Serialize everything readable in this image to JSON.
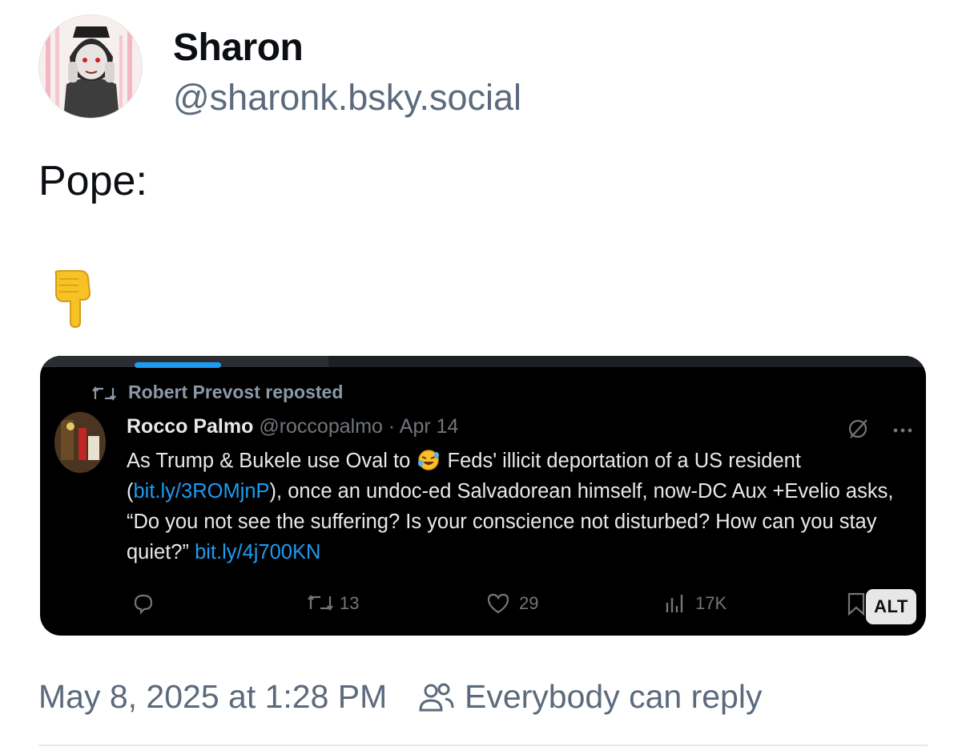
{
  "author": {
    "name": "Sharon",
    "handle": "@sharonk.bsky.social"
  },
  "post": {
    "text": "Pope:",
    "emoji": "👇"
  },
  "embedded_screenshot": {
    "repost_label": "Robert Prevost reposted",
    "name": "Rocco Palmo",
    "handle": "@roccopalmo",
    "separator": "·",
    "date": "Apr 14",
    "text_1": "As Trump & Bukele use Oval to ",
    "text_2": " Feds' illicit deportation of a US resident (",
    "link_1": "bit.ly/3ROMjnP",
    "text_3": "), once an undoc-ed Salvadorean himself, now-DC Aux +Evelio asks, “Do you not see the suffering? Is your conscience not disturbed? How can you stay quiet?” ",
    "link_2": "bit.ly/4j700KN",
    "reposts": "13",
    "likes": "29",
    "views": "17K",
    "alt_badge": "ALT",
    "accent_color": "#1d9bf0"
  },
  "footer": {
    "timestamp": "May 8, 2025 at 1:28 PM",
    "reply_setting": "Everybody can reply"
  }
}
